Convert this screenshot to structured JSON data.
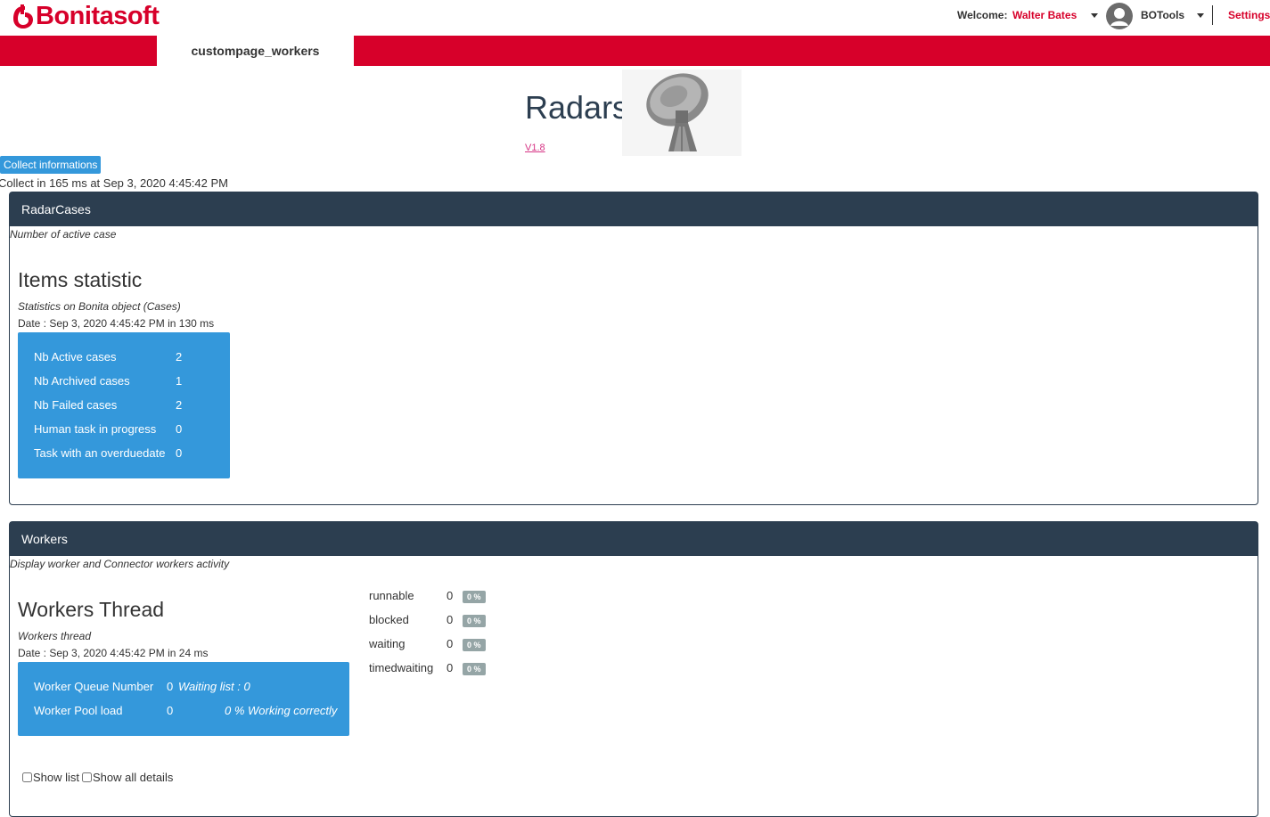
{
  "header": {
    "logo_text": "Bonitasoft",
    "welcome_label": "Welcome:",
    "user_name": "Walter Bates",
    "app_name": "BOTools",
    "settings_label": "Settings"
  },
  "tabs": [
    {
      "label": "custompage_workers",
      "active": true
    }
  ],
  "page": {
    "title": "Radars",
    "version": "V1.8",
    "collect_button": "Collect informations",
    "collect_status": "Collect in 165 ms at Sep 3, 2020 4:45:42 PM"
  },
  "radar_cases": {
    "panel_title": "RadarCases",
    "description": "Number of active case",
    "heading": "Items statistic",
    "subheading": "Statistics on Bonita object (Cases)",
    "date": "Date : Sep 3, 2020 4:45:42 PM in 130 ms",
    "rows": [
      {
        "label": "Nb Active cases",
        "value": "2"
      },
      {
        "label": "Nb Archived cases",
        "value": "1"
      },
      {
        "label": "Nb Failed cases",
        "value": "2"
      },
      {
        "label": "Human task in progress",
        "value": "0"
      },
      {
        "label": "Task with an overduedate",
        "value": "0"
      }
    ]
  },
  "workers": {
    "panel_title": "Workers",
    "description": "Display worker and Connector workers activity",
    "heading": "Workers Thread",
    "subheading": "Workers thread",
    "date": "Date : Sep 3, 2020 4:45:42 PM in 24 ms",
    "queue_label": "Worker Queue Number",
    "queue_value": "0",
    "waiting_list": "Waiting list : 0",
    "pool_label": "Worker Pool load",
    "pool_value": "0",
    "pool_status": "0 % Working correctly",
    "states": [
      {
        "label": "runnable",
        "value": "0",
        "pct": "0 %"
      },
      {
        "label": "blocked",
        "value": "0",
        "pct": "0 %"
      },
      {
        "label": "waiting",
        "value": "0",
        "pct": "0 %"
      },
      {
        "label": "timedwaiting",
        "value": "0",
        "pct": "0 %"
      }
    ],
    "show_list_label": "Show list",
    "show_all_details_label": "Show all details"
  },
  "colors": {
    "brand": "#d7002a",
    "panel_header": "#2c3e50",
    "stat_box": "#3498db"
  }
}
